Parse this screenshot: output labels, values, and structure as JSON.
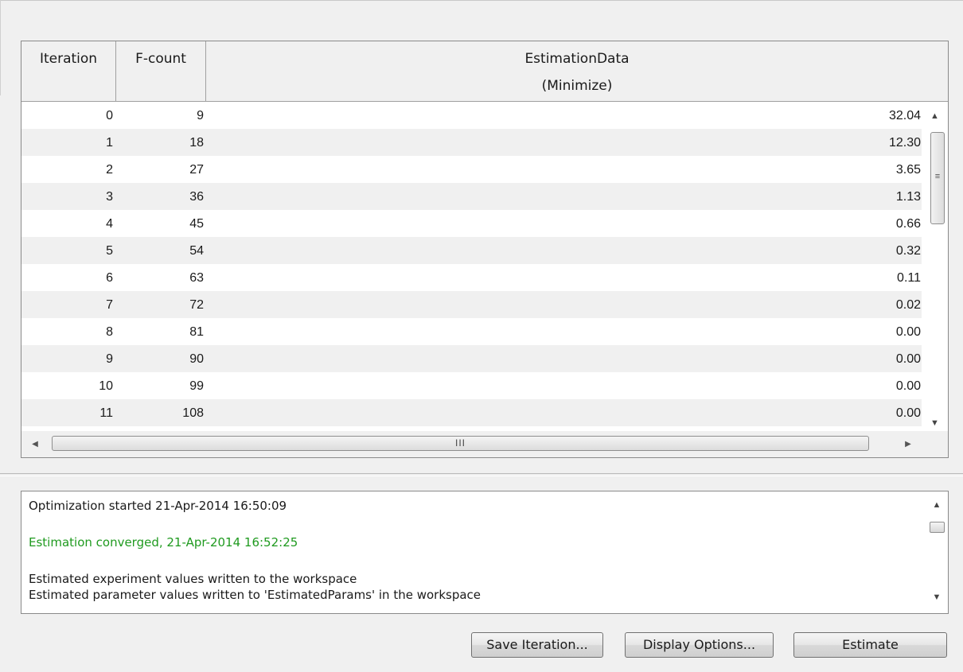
{
  "table": {
    "headers": {
      "iteration": "Iteration",
      "fcount": "F-count",
      "estimation_line1": "EstimationData",
      "estimation_line2": "(Minimize)"
    },
    "rows": [
      {
        "iteration": "0",
        "fcount": "9",
        "value": "32.04"
      },
      {
        "iteration": "1",
        "fcount": "18",
        "value": "12.30"
      },
      {
        "iteration": "2",
        "fcount": "27",
        "value": "3.65"
      },
      {
        "iteration": "3",
        "fcount": "36",
        "value": "1.13"
      },
      {
        "iteration": "4",
        "fcount": "45",
        "value": "0.66"
      },
      {
        "iteration": "5",
        "fcount": "54",
        "value": "0.32"
      },
      {
        "iteration": "6",
        "fcount": "63",
        "value": "0.11"
      },
      {
        "iteration": "7",
        "fcount": "72",
        "value": "0.02"
      },
      {
        "iteration": "8",
        "fcount": "81",
        "value": "0.00"
      },
      {
        "iteration": "9",
        "fcount": "90",
        "value": "0.00"
      },
      {
        "iteration": "10",
        "fcount": "99",
        "value": "0.00"
      },
      {
        "iteration": "11",
        "fcount": "108",
        "value": "0.00"
      }
    ],
    "scroll_grip": "III"
  },
  "log": {
    "line1": "Optimization started 21-Apr-2014 16:50:09",
    "line2": "Estimation converged, 21-Apr-2014 16:52:25",
    "line3": "Estimated experiment values written to the workspace",
    "line4": "Estimated parameter values written to 'EstimatedParams' in the workspace",
    "success_color": "#1f9a1f"
  },
  "buttons": {
    "save": "Save Iteration...",
    "display": "Display Options...",
    "estimate": "Estimate"
  }
}
